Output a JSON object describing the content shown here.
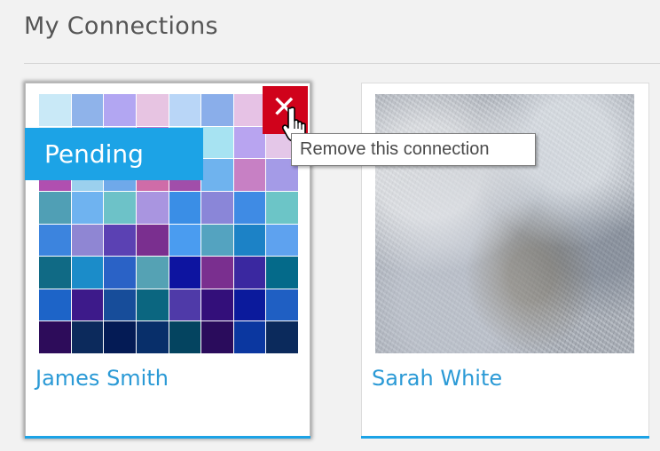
{
  "page": {
    "title": "My Connections"
  },
  "connections": [
    {
      "name": "James Smith",
      "status": "Pending",
      "avatar": "colored-mosaic",
      "mosaic_colors": [
        "#c9e9f7",
        "#8fb3ea",
        "#b2a6f2",
        "#e7c4e2",
        "#b9d6f7",
        "#8aaeea",
        "#e6c2e5",
        "#d9b5e6",
        "#e2f3fb",
        "#9fd7f3",
        "#b5c2f5",
        "#c07ad0",
        "#a3e4f4",
        "#a7e3f2",
        "#b8a4f0",
        "#e4c7e8",
        "#b04fb0",
        "#9bd0ee",
        "#6fa9ea",
        "#cf6ca8",
        "#a14eaa",
        "#6fb3ee",
        "#c780c4",
        "#a49be7",
        "#509fb5",
        "#6fb3f0",
        "#6dc2c8",
        "#a995e0",
        "#3a8ee6",
        "#8a86d8",
        "#3f8be4",
        "#6cc5c7",
        "#3c84de",
        "#8f86d3",
        "#5b41b3",
        "#7a2f8f",
        "#4a9cf0",
        "#54a3c0",
        "#1c82c6",
        "#5ea2ef",
        "#106a85",
        "#1b8cc9",
        "#2a62c6",
        "#55a2b4",
        "#0d14a0",
        "#7a2f8f",
        "#3a28a0",
        "#046a8a",
        "#1d64c8",
        "#3d1a8a",
        "#174d9a",
        "#0b6680",
        "#4f3aa8",
        "#330f7a",
        "#0b1a9c",
        "#1f5fc3",
        "#2d0c5a",
        "#0c2a5c",
        "#041b55",
        "#082f6a",
        "#044460",
        "#2a0c5c",
        "#0b37a0",
        "#0b2a5c"
      ]
    },
    {
      "name": "Sarah White",
      "avatar": "gray-texture"
    }
  ],
  "remove": {
    "glyph": "✕",
    "tooltip": "Remove this connection"
  },
  "colors": {
    "accent": "#1ca3e6",
    "link": "#2b9ad6",
    "remove_bg": "#d0021b"
  }
}
